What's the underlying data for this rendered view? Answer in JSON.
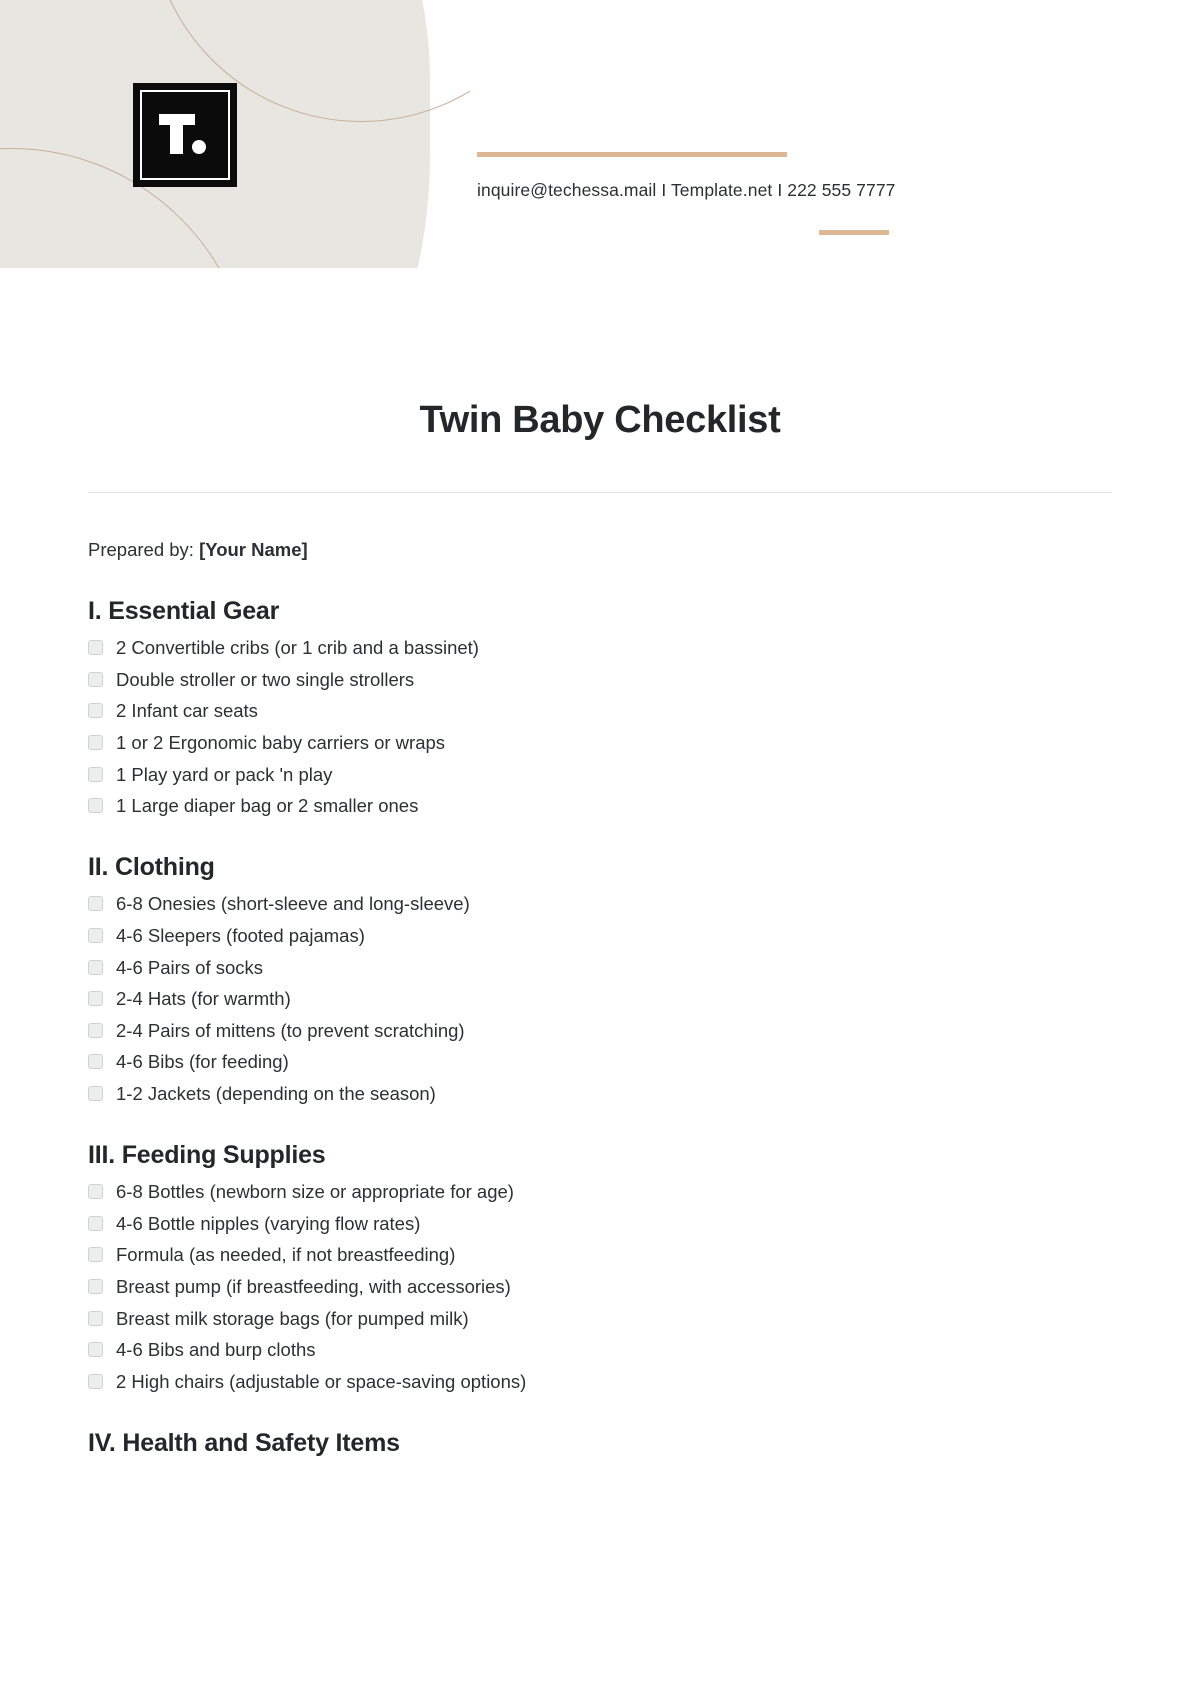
{
  "brand": {
    "logo_mark": "T.",
    "accent_color": "#DDB895",
    "panel_color": "#E8E6E0",
    "logo_bg_color": "#0b0b0b"
  },
  "header": {
    "contact_line": "inquire@techessa.mail  I  Template.net  I  222 555 7777"
  },
  "document": {
    "title": "Twin Baby Checklist",
    "prepared_by_label": "Prepared by:",
    "prepared_by_value": "[Your Name]"
  },
  "sections": [
    {
      "heading": "I. Essential Gear",
      "items": [
        "2 Convertible cribs (or 1 crib and a bassinet)",
        "Double stroller or two single strollers",
        "2 Infant car seats",
        "1 or 2 Ergonomic baby carriers or wraps",
        "1 Play yard or pack 'n play",
        "1 Large diaper bag or 2 smaller ones"
      ]
    },
    {
      "heading": "II. Clothing",
      "items": [
        "6-8 Onesies (short-sleeve and long-sleeve)",
        "4-6 Sleepers (footed pajamas)",
        "4-6 Pairs of socks",
        "2-4 Hats (for warmth)",
        "2-4 Pairs of mittens (to prevent scratching)",
        "4-6 Bibs (for feeding)",
        "1-2 Jackets (depending on the season)"
      ]
    },
    {
      "heading": "III. Feeding Supplies",
      "items": [
        "6-8 Bottles (newborn size or appropriate for age)",
        "4-6 Bottle nipples (varying flow rates)",
        "Formula (as needed, if not breastfeeding)",
        "Breast pump (if breastfeeding, with accessories)",
        "Breast milk storage bags (for pumped milk)",
        "4-6 Bibs and burp cloths",
        "2 High chairs (adjustable or space-saving options)"
      ]
    },
    {
      "heading": "IV. Health and Safety Items",
      "items": []
    }
  ]
}
